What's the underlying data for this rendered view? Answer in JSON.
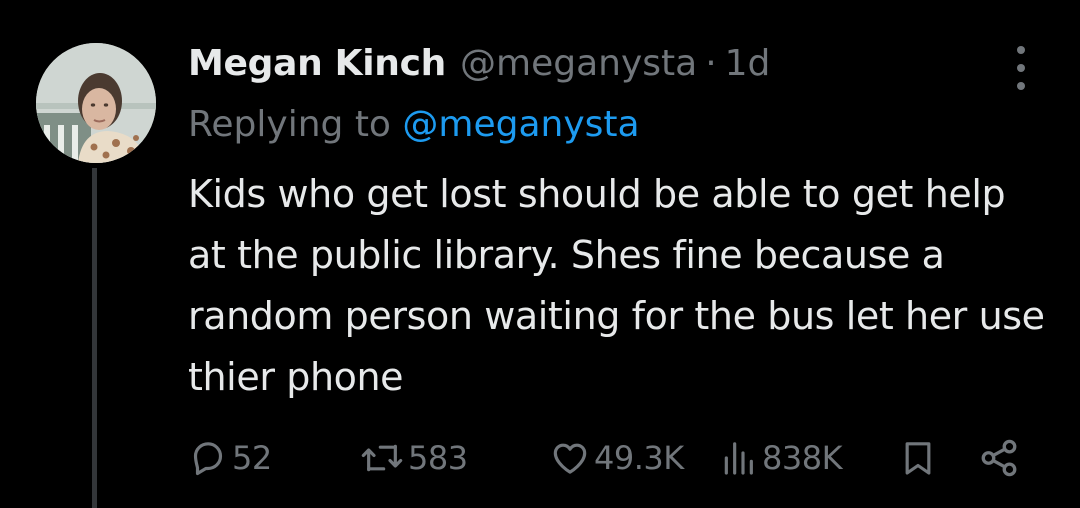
{
  "colors": {
    "background": "#000000",
    "primary_text": "#e7e9ea",
    "secondary_text": "#71767b",
    "link": "#1d9bf0",
    "thread_line": "#333639"
  },
  "tweet": {
    "author_name": "Megan Kinch",
    "author_handle": "@meganysta",
    "separator": "·",
    "time_ago": "1d",
    "replying_prefix": "Replying to",
    "replying_handle": "@meganysta",
    "text": "Kids who get lost should be able to get help at the public library. Shes fine because a random person waiting for the bus let her use thier phone",
    "avatar_icon": "user-photo-avatar",
    "more_icon": "more-vertical-icon"
  },
  "actions": {
    "replies": {
      "icon": "reply-icon",
      "count": "52"
    },
    "retweets": {
      "icon": "retweet-icon",
      "count": "583"
    },
    "likes": {
      "icon": "heart-icon",
      "count": "49.3K"
    },
    "views": {
      "icon": "views-chart-icon",
      "count": "838K"
    },
    "bookmark": {
      "icon": "bookmark-icon"
    },
    "share": {
      "icon": "share-icon"
    }
  }
}
